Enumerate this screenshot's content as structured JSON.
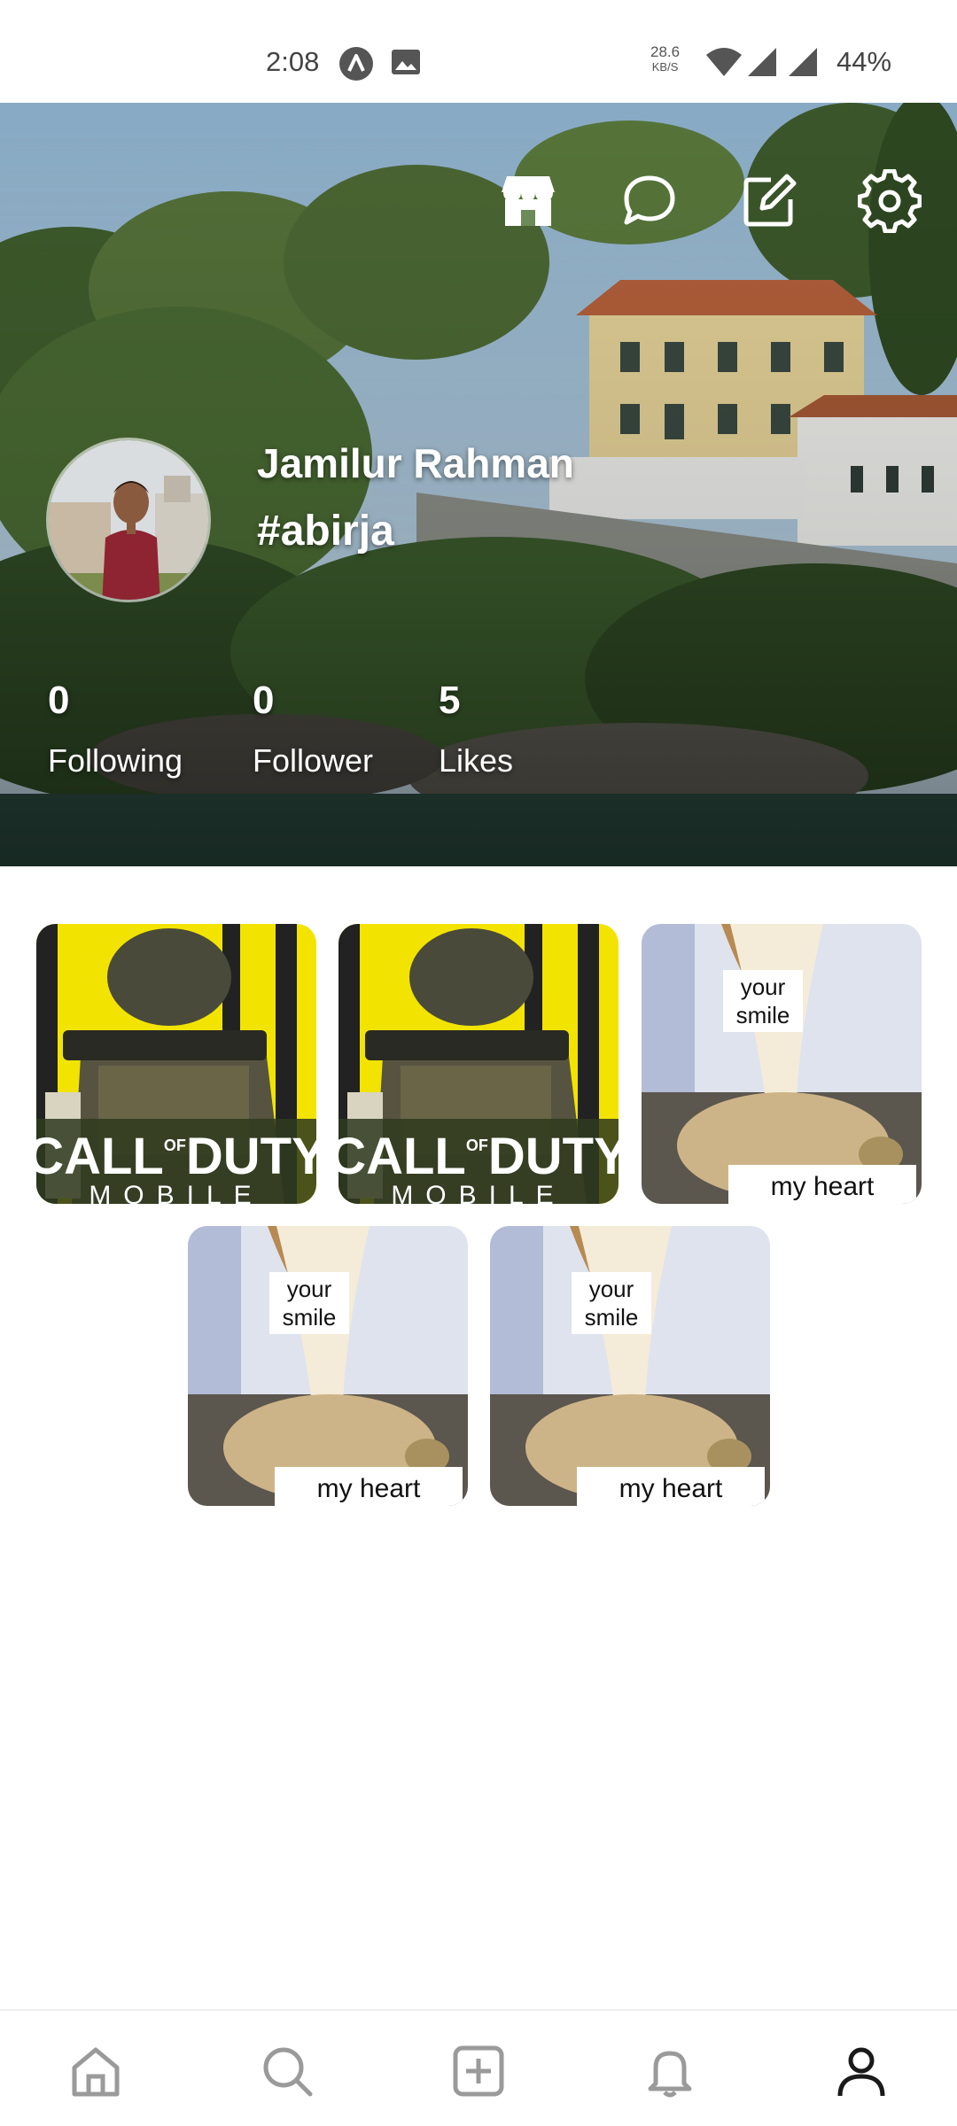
{
  "status_bar": {
    "time": "2:08",
    "net_speed_value": "28.6",
    "net_speed_unit": "KB/S",
    "battery": "44%",
    "icons": [
      "app-notification-icon",
      "image-notification-icon",
      "wifi-icon",
      "signal-icon",
      "signal-icon",
      "battery-text"
    ]
  },
  "header": {
    "top_icons": [
      "store-icon",
      "chat-icon",
      "edit-icon",
      "settings-icon"
    ],
    "profile": {
      "name": "Jamilur Rahman",
      "handle": "#abirja"
    },
    "stats": [
      {
        "value": "0",
        "label": "Following"
      },
      {
        "value": "0",
        "label": "Follower"
      },
      {
        "value": "5",
        "label": "Likes"
      }
    ]
  },
  "posts": [
    {
      "kind": "call-of-duty",
      "title": "CALL",
      "of": "OF",
      "title2": "DUTY",
      "subtitle": "MOBILE"
    },
    {
      "kind": "call-of-duty",
      "title": "CALL",
      "of": "OF",
      "title2": "DUTY",
      "subtitle": "MOBILE"
    },
    {
      "kind": "meme",
      "top": "your smile",
      "top_line1": "your",
      "top_line2": "smile",
      "bottom": "my heart"
    },
    {
      "kind": "meme",
      "top": "your smile",
      "top_line1": "your",
      "top_line2": "smile",
      "bottom": "my heart"
    },
    {
      "kind": "meme",
      "top": "your smile",
      "top_line1": "your",
      "top_line2": "smile",
      "bottom": "my heart"
    }
  ],
  "bottom_nav": {
    "items": [
      "home-icon",
      "search-icon",
      "add-post-icon",
      "notifications-icon",
      "profile-icon"
    ],
    "active": "profile-icon"
  },
  "colors": {
    "accent_yellow": "#f2e400",
    "text_dark": "#111111",
    "nav_icon": "#9a9a9a",
    "nav_active": "#1a1a1a"
  }
}
